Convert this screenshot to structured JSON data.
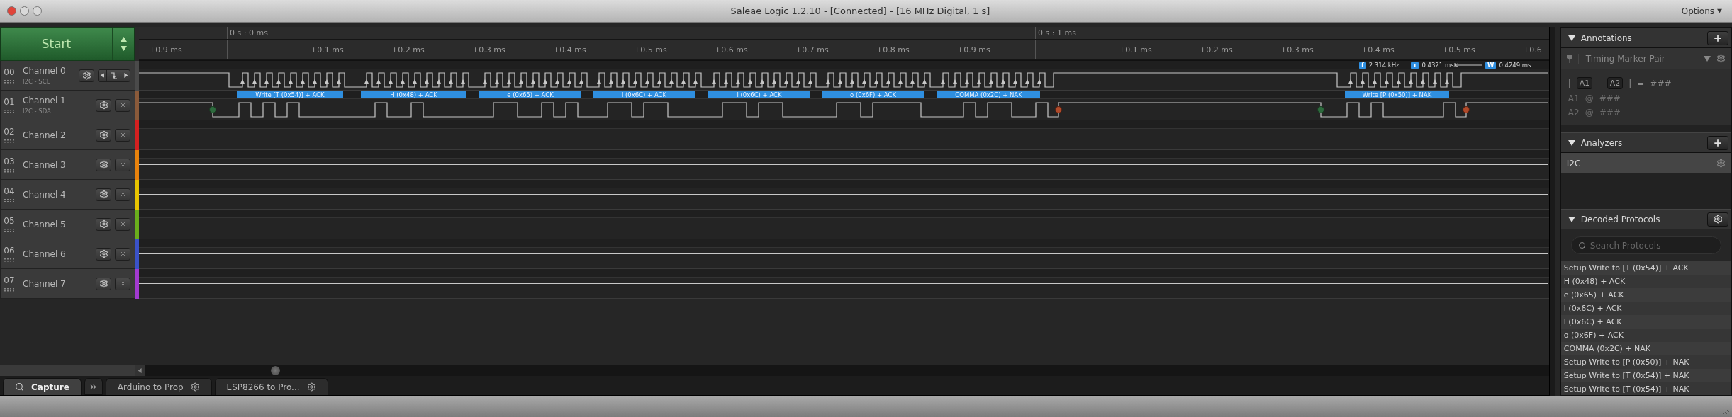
{
  "window": {
    "title": "Saleae Logic 1.2.10 - [Connected] - [16 MHz Digital, 1 s]",
    "menu": "Options"
  },
  "start_button": {
    "label": "Start"
  },
  "timeline": {
    "major_ticks": [
      "0 s : 0 ms",
      "0 s : 1 ms"
    ],
    "minor_ticks": [
      "+0.9 ms",
      "+0.1 ms",
      "+0.2 ms",
      "+0.3 ms",
      "+0.4 ms",
      "+0.5 ms",
      "+0.6 ms",
      "+0.7 ms",
      "+0.8 ms",
      "+0.9 ms",
      "+0.1 ms",
      "+0.2 ms",
      "+0.3 ms",
      "+0.4 ms",
      "+0.5 ms",
      "+0.6"
    ]
  },
  "channels": [
    {
      "number": "00",
      "name": "Channel 0",
      "subtitle": "I2C - SCL",
      "color": "#4a4a4a",
      "kind": "clock"
    },
    {
      "number": "01",
      "name": "Channel 1",
      "subtitle": "I2C - SDA",
      "color": "#8a5a3a",
      "kind": "data"
    },
    {
      "number": "02",
      "name": "Channel 2",
      "color": "#d42020",
      "kind": "flat"
    },
    {
      "number": "03",
      "name": "Channel 3",
      "color": "#e8820c",
      "kind": "flat"
    },
    {
      "number": "04",
      "name": "Channel 4",
      "color": "#e8c400",
      "kind": "flat"
    },
    {
      "number": "05",
      "name": "Channel 5",
      "color": "#6aae1c",
      "kind": "flat"
    },
    {
      "number": "06",
      "name": "Channel 6",
      "color": "#3a52c8",
      "kind": "flat"
    },
    {
      "number": "07",
      "name": "Channel 7",
      "color": "#a23ad0",
      "kind": "flat"
    }
  ],
  "measurements": [
    {
      "symbol": "f",
      "value": "2.314 kHz"
    },
    {
      "symbol": "τ",
      "value": "0.4321 ms"
    },
    {
      "symbol": "W",
      "value": "0.4249 ms"
    }
  ],
  "decoded_frames": [
    "Write [T (0x54)] + ACK",
    "H (0x48) + ACK",
    "e (0x65) + ACK",
    "l (0x6C) + ACK",
    "l (0x6C) + ACK",
    "o (0x6F) + ACK",
    "COMMA (0x2C) + NAK",
    "Write [P (0x50)] + NAK"
  ],
  "annotations": {
    "title": "Annotations",
    "marker_type": "Timing Marker Pair",
    "formula": [
      {
        "kind": "text",
        "text": "|"
      },
      {
        "kind": "marker",
        "text": "A1"
      },
      {
        "kind": "text",
        "text": "-"
      },
      {
        "kind": "marker",
        "text": "A2"
      },
      {
        "kind": "text",
        "text": "|"
      },
      {
        "kind": "text",
        "text": "="
      },
      {
        "kind": "text",
        "text": "###"
      }
    ],
    "rows": [
      {
        "marker": "A1",
        "at": "@",
        "value": "###"
      },
      {
        "marker": "A2",
        "at": "@",
        "value": "###"
      }
    ]
  },
  "analyzers": {
    "title": "Analyzers",
    "items": [
      {
        "label": "I2C",
        "selected": true
      }
    ]
  },
  "decoded_protocols": {
    "title": "Decoded Protocols",
    "search_placeholder": "Search Protocols",
    "items": [
      "Setup Write to [T (0x54)] + ACK",
      "H (0x48) + ACK",
      "e (0x65) + ACK",
      "l (0x6C) + ACK",
      "l (0x6C) + ACK",
      "o (0x6F) + ACK",
      "COMMA (0x2C) + NAK",
      "Setup Write to [P (0x50)] + NAK",
      "Setup Write to [T (0x54)] + NAK",
      "Setup Write to [T (0x54)] + NAK"
    ]
  },
  "tabs": [
    {
      "label": "Capture",
      "kind": "capture",
      "selected": true
    },
    {
      "label": "Arduino to Prop",
      "kind": "analyzer",
      "selected": false
    },
    {
      "label": "ESP8266 to Pro...",
      "kind": "analyzer",
      "selected": false
    }
  ]
}
